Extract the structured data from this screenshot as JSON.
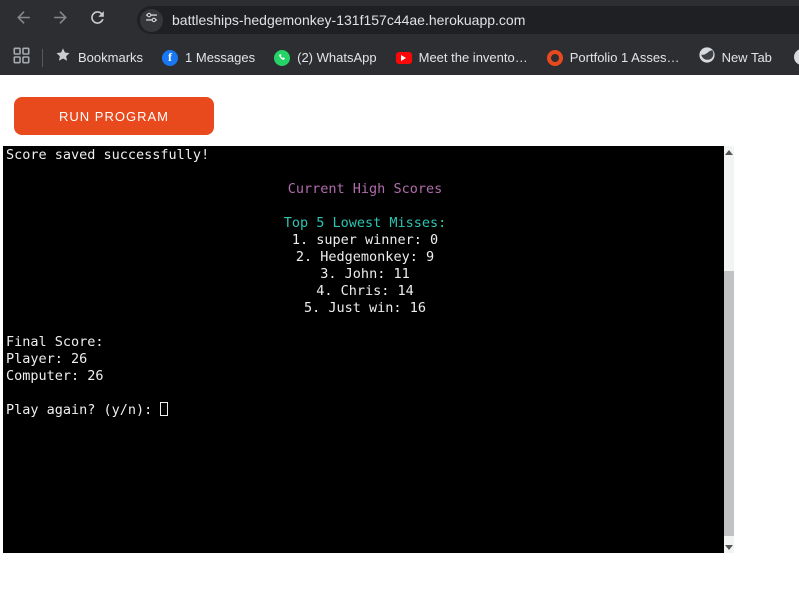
{
  "browser": {
    "url": "battleships-hedgemonkey-131f157c44ae.herokuapp.com"
  },
  "bookmarks_bar": {
    "items": [
      {
        "icon": "star-icon",
        "label": "Bookmarks"
      },
      {
        "icon": "facebook-icon",
        "label": "1 Messages"
      },
      {
        "icon": "whatsapp-icon",
        "label": "(2) WhatsApp"
      },
      {
        "icon": "youtube-icon",
        "label": "Meet the invento…"
      },
      {
        "icon": "orange-ring-icon",
        "label": "Portfolio 1 Asses…"
      },
      {
        "icon": "globe-icon",
        "label": "New Tab"
      }
    ]
  },
  "page": {
    "run_button_label": "RUN PROGRAM"
  },
  "terminal": {
    "lines": [
      "Score saved successfully!",
      "",
      "Current High Scores",
      "",
      "Top 5 Lowest Misses:",
      "1. super winner: 0",
      "2. Hedgemonkey: 9",
      "3. John: 11",
      "4. Chris: 14",
      "5. Just win: 16",
      "",
      "Final Score:",
      "Player: 26",
      "Computer: 26",
      "",
      "Play again? (y/n): "
    ]
  },
  "colors": {
    "accent_orange": "#e8491d",
    "terminal_background": "#000000",
    "terminal_white": "#eeeeee",
    "terminal_purple": "#b06cac",
    "terminal_teal": "#2cc5b2",
    "facebook_blue": "#1877f2",
    "whatsapp_green": "#25d366",
    "youtube_red": "#fd0808",
    "toolbar_background": "#2d2e31"
  }
}
